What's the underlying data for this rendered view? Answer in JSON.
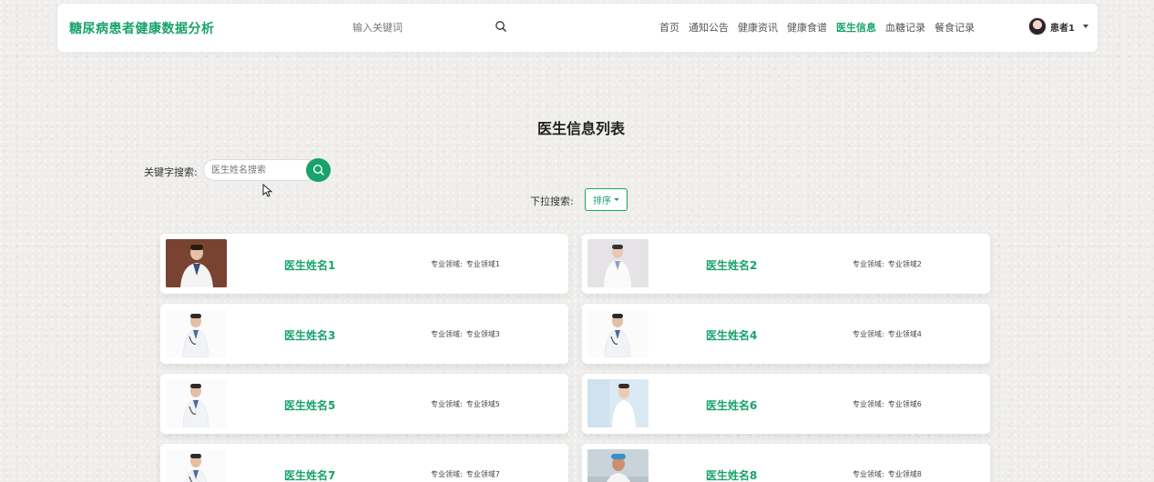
{
  "header": {
    "brand": "糖尿病患者健康数据分析",
    "search_placeholder": "输入关键词",
    "nav": [
      "首页",
      "通知公告",
      "健康资讯",
      "健康食谱",
      "医生信息",
      "血糖记录",
      "餐食记录"
    ],
    "active_nav": "医生信息",
    "username": "患者1"
  },
  "page": {
    "title": "医生信息列表",
    "keyword_label": "关键字搜索:",
    "keyword_placeholder": "医生姓名搜索",
    "dropdown_label": "下拉搜索:",
    "sort_label": "排序"
  },
  "doctors": [
    {
      "name": "医生姓名1",
      "field_label": "专业领域:",
      "field": "专业领域1",
      "photo": "dark-bg"
    },
    {
      "name": "医生姓名2",
      "field_label": "专业领域:",
      "field": "专业领域2",
      "photo": "light-bg"
    },
    {
      "name": "医生姓名3",
      "field_label": "专业领域:",
      "field": "专业领域3",
      "photo": "white-bg"
    },
    {
      "name": "医生姓名4",
      "field_label": "专业领域:",
      "field": "专业领域4",
      "photo": "white-bg"
    },
    {
      "name": "医生姓名5",
      "field_label": "专业领域:",
      "field": "专业领域5",
      "photo": "white-bg"
    },
    {
      "name": "医生姓名6",
      "field_label": "专业领域:",
      "field": "专业领域6",
      "photo": "blue-bg"
    },
    {
      "name": "医生姓名7",
      "field_label": "专业领域:",
      "field": "专业领域7",
      "photo": "white-bg"
    },
    {
      "name": "医生姓名8",
      "field_label": "专业领域:",
      "field": "专业领域8",
      "photo": "clinic-bg"
    }
  ],
  "colors": {
    "accent": "#17a36b",
    "background": "#efeeec"
  }
}
